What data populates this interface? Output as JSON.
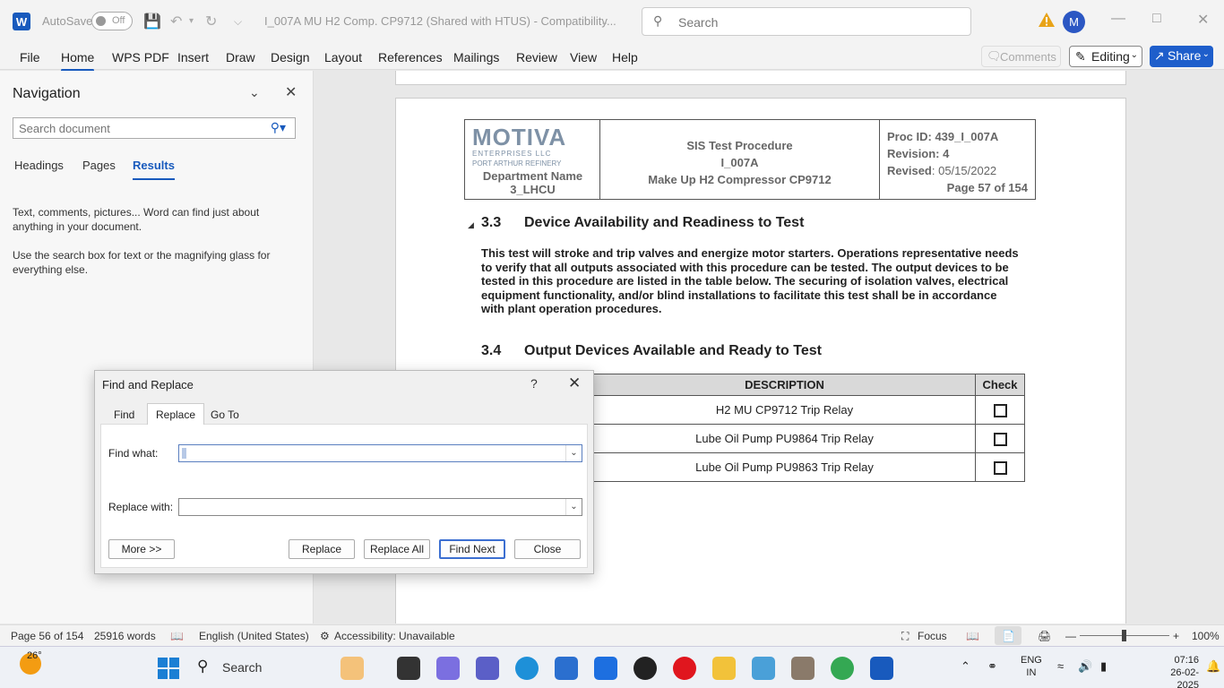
{
  "titlebar": {
    "app_logo": "W",
    "autosave_label": "AutoSave",
    "autosave_state": "Off",
    "document_title": "I_007A MU H2 Comp. CP9712 (Shared with HTUS)  -  Compatibility...",
    "search_placeholder": "Search",
    "avatar_initial": "M"
  },
  "ribbon": {
    "tabs": [
      "File",
      "Home",
      "WPS PDF",
      "Insert",
      "Draw",
      "Design",
      "Layout",
      "References",
      "Mailings",
      "Review",
      "View",
      "Help"
    ],
    "active_tab": "Home",
    "comments_label": "Comments",
    "editing_label": "Editing",
    "share_label": "Share"
  },
  "navigation": {
    "title": "Navigation",
    "search_placeholder": "Search document",
    "tabs": [
      "Headings",
      "Pages",
      "Results"
    ],
    "active_tab": "Results",
    "help_line1": "Text, comments, pictures... Word can find just about anything in your document.",
    "help_line2": "Use the search box for text or the magnifying glass for everything else."
  },
  "document": {
    "header": {
      "logo_text": "MOTIVA",
      "logo_sub": "ENTERPRISES LLC",
      "refinery": "PORT ARTHUR REFINERY",
      "dept_line1": "Department Name",
      "dept_line2": "3_LHCU",
      "center_line1": "SIS Test Procedure",
      "center_line2": "I_007A",
      "center_line3": "Make Up H2 Compressor CP9712",
      "proc_id": "Proc ID: 439_I_007A",
      "revision": "Revision: 4",
      "revised_label": "Revised",
      "revised_date": ": 05/15/2022",
      "page_of": "Page 57 of 154"
    },
    "section33_num": "3.3",
    "section33_title": "Device Availability and Readiness to Test",
    "section33_body": "This test will stroke and trip valves and energize motor starters. Operations representative needs to verify that all outputs associated with this procedure can be tested. The output devices to be tested in this procedure are listed in the table below. The securing of isolation valves, electrical equipment functionality, and/or blind installations to facilitate this test shall be in accordance with plant operation procedures.",
    "section34_num": "3.4",
    "section34_title": "Output Devices Available and Ready to Test",
    "table": {
      "headers": [
        "DESCRIPTION",
        "Check"
      ],
      "rows": [
        {
          "description": "H2 MU CP9712 Trip Relay"
        },
        {
          "description": "Lube Oil Pump PU9864 Trip Relay"
        },
        {
          "description": "Lube Oil Pump PU9863 Trip Relay"
        }
      ]
    }
  },
  "dialog": {
    "title": "Find and Replace",
    "help": "?",
    "tabs": [
      "Find",
      "Replace",
      "Go To"
    ],
    "active_tab": "Replace",
    "find_label": "Find what:",
    "find_value": "",
    "replace_label": "Replace with:",
    "replace_value": "",
    "more_button": "More >>",
    "replace_button": "Replace",
    "replace_all_button": "Replace All",
    "find_next_button": "Find Next",
    "close_button": "Close"
  },
  "statusbar": {
    "page": "Page 56 of 154",
    "words": "25916 words",
    "language": "English (United States)",
    "accessibility": "Accessibility: Unavailable",
    "focus": "Focus",
    "zoom": "100%"
  },
  "taskbar": {
    "temperature": "26°",
    "search_label": "Search",
    "lang_line1": "ENG",
    "lang_line2": "IN",
    "time": "07:16",
    "date": "26-02-2025"
  },
  "colors": {
    "accent": "#185abd",
    "share": "#1e5ecb",
    "table_header": "#d9d9d9"
  }
}
